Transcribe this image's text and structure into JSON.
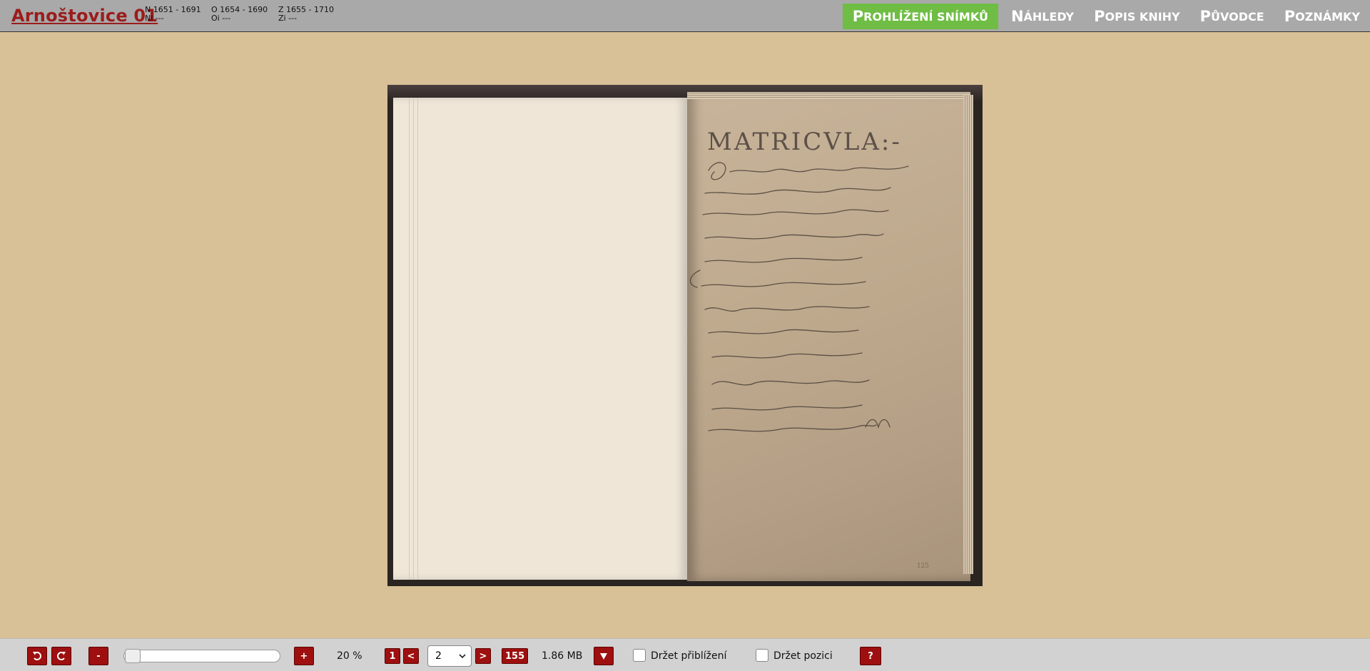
{
  "header": {
    "book_title": "Arnoštovice 01",
    "meta": [
      {
        "line1": "N 1651 - 1691",
        "line2": "Ni ---"
      },
      {
        "line1": "O 1654 - 1690",
        "line2": "Oi ---"
      },
      {
        "line1": "Z 1655 - 1710",
        "line2": "Zi ---"
      }
    ],
    "nav": [
      {
        "first": "P",
        "rest": "ROHLÍŽENÍ SNÍMKŮ",
        "active": true
      },
      {
        "first": "N",
        "rest": "ÁHLEDY",
        "active": false
      },
      {
        "first": "P",
        "rest": "OPIS KNIHY",
        "active": false
      },
      {
        "first": "P",
        "rest": "ŮVODCE",
        "active": false
      },
      {
        "first": "P",
        "rest": "OZNÁMKY",
        "active": false
      }
    ],
    "active_color": "#6fbd44",
    "title_color": "#9b1c1c"
  },
  "viewer": {
    "manuscript_heading": "MATRICVLA:-",
    "folio_number": "125"
  },
  "toolbar": {
    "rotate_left_icon": "rotate-left-icon",
    "rotate_right_icon": "rotate-right-icon",
    "zoom_out_label": "-",
    "zoom_in_label": "+",
    "zoom_level": 0.0,
    "zoom_text": "20 %",
    "first_page_label": "1",
    "prev_label": "<",
    "current_page": "2",
    "next_label": ">",
    "last_page_label": "155",
    "file_size": "1.86 MB",
    "download_icon": "download-arrow-icon",
    "keep_zoom_label": "Držet přiblížení",
    "keep_position_label": "Držet pozici",
    "help_label": "?",
    "button_color": "#9e0f0f"
  }
}
